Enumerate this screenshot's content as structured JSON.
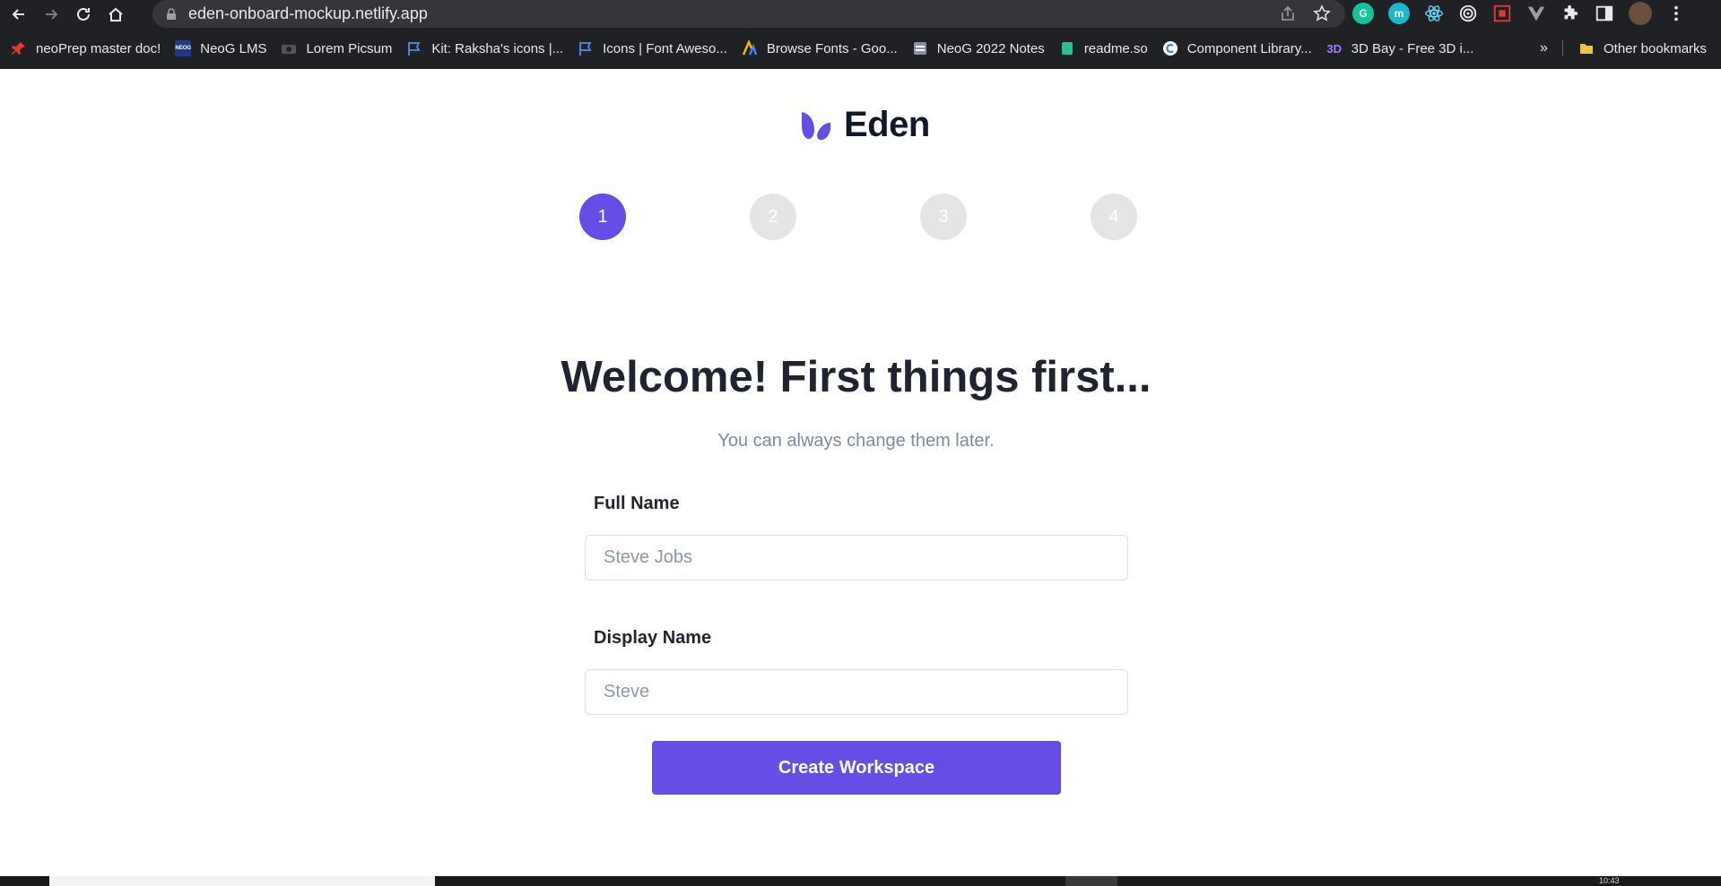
{
  "browser": {
    "url": "eden-onboard-mockup.netlify.app",
    "bookmarks": [
      {
        "label": "neoPrep master doc!",
        "icon": "pin-icon"
      },
      {
        "label": "NeoG LMS",
        "icon": "neog-icon"
      },
      {
        "label": "Lorem Picsum",
        "icon": "camera-icon"
      },
      {
        "label": "Kit: Raksha's icons |...",
        "icon": "flag-icon"
      },
      {
        "label": "Icons | Font Aweso...",
        "icon": "flag-icon"
      },
      {
        "label": "Browse Fonts - Goo...",
        "icon": "fonts-icon"
      },
      {
        "label": "NeoG 2022 Notes",
        "icon": "notes-icon"
      },
      {
        "label": "readme.so",
        "icon": "readme-icon"
      },
      {
        "label": "Component Library...",
        "icon": "component-icon"
      },
      {
        "label": "3D Bay - Free 3D i...",
        "icon": "3d-icon"
      }
    ],
    "other_bookmarks": "Other bookmarks",
    "overflow": "»",
    "neog_icon_text": "NEOG",
    "threed_icon_text": "3D",
    "grammarly_text": "G",
    "m_ext_text": "m"
  },
  "brand": {
    "name": "Eden",
    "color": "#664de5"
  },
  "stepper": {
    "steps": [
      "1",
      "2",
      "3",
      "4"
    ],
    "active": 1,
    "active_color": "#664de5",
    "inactive_color": "#e5e5e5"
  },
  "onboarding": {
    "headline": "Welcome! First things first...",
    "subline": "You can always change them later.",
    "full_name_label": "Full Name",
    "full_name_placeholder": "Steve Jobs",
    "display_name_label": "Display Name",
    "display_name_placeholder": "Steve",
    "cta_label": "Create Workspace"
  },
  "taskbar": {
    "clock": "10:43"
  }
}
